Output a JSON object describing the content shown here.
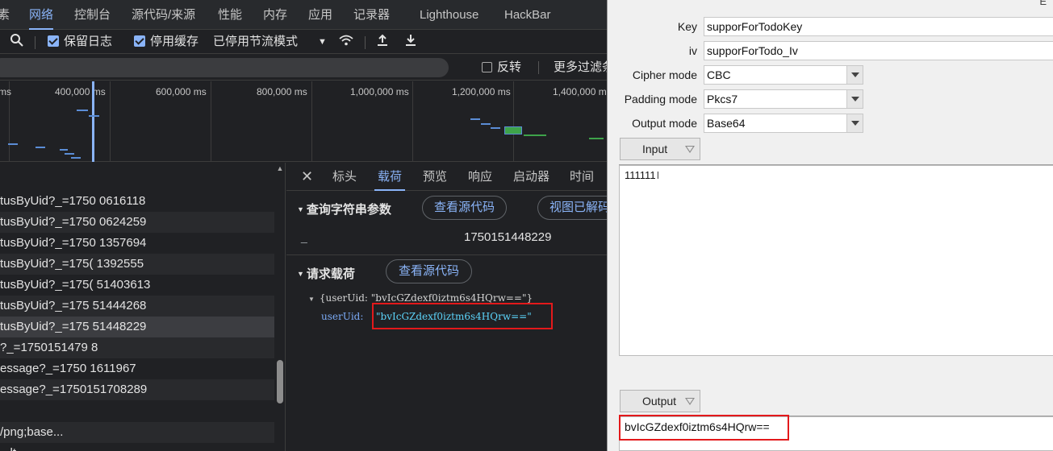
{
  "devtools": {
    "tabs": [
      {
        "label": "素"
      },
      {
        "label": "网络"
      },
      {
        "label": "控制台"
      },
      {
        "label": "源代码/来源"
      },
      {
        "label": "性能"
      },
      {
        "label": "内存"
      },
      {
        "label": "应用"
      },
      {
        "label": "记录器"
      },
      {
        "label": "Lighthouse"
      },
      {
        "label": "HackBar"
      }
    ],
    "active_tab": "网络",
    "toolbar": {
      "preserve_log": "保留日志",
      "disable_cache": "停用缓存",
      "throttling": "已停用节流模式"
    },
    "filter": {
      "invert": "反转",
      "more_filters": "更多过滤条"
    },
    "overview": {
      "labels": [
        "ms",
        "400,000 ms",
        "600,000 ms",
        "800,000 ms",
        "1,000,000 ms",
        "1,200,000 ms",
        "1,400,000 ms"
      ]
    },
    "requests": [
      "tusByUid?_=1750  0616118",
      "tusByUid?_=1750  0624259",
      "tusByUid?_=1750  1357694",
      "tusByUid?_=175(  1392555",
      "tusByUid?_=175(  51403613",
      "tusByUid?_=175   51444268",
      "tusByUid?_=175   51448229",
      "?_=1750151479  8",
      "essage?_=1750  1611967",
      "essage?_=1750151708289",
      "",
      "/png;base...",
      "...lt..."
    ],
    "selected_request_index": 6,
    "detail": {
      "tabs": [
        "标头",
        "载荷",
        "预览",
        "响应",
        "启动器",
        "时间"
      ],
      "active_tab": "载荷",
      "query_title": "查询字符串参数",
      "view_source": "查看源代码",
      "view_decoded": "视图已解码",
      "query_key": "_",
      "query_value": "1750151448229",
      "payload_title": "请求载荷",
      "payload_view_source": "查看源代码",
      "payload_summary": "{userUid: \"bvIcGZdexf0iztm6s4HQrw==\"}",
      "payload_key": "userUid:",
      "payload_value": "\"bvIcGZdexf0iztm6s4HQrw==\""
    }
  },
  "tool": {
    "title_stub": "E",
    "key_label": "Key",
    "key_value": "supporForTodoKey",
    "iv_label": "iv",
    "iv_value": "supporForTodo_Iv",
    "cipher_mode_label": "Cipher mode",
    "cipher_mode_value": "CBC",
    "padding_mode_label": "Padding mode",
    "padding_mode_value": "Pkcs7",
    "output_mode_label": "Output mode",
    "output_mode_value": "Base64",
    "input_header": "Input",
    "input_value": "111111",
    "output_header": "Output",
    "output_value": "bvIcGZdexf0iztm6s4HQrw=="
  },
  "colors": {
    "accent": "#8ab4f8",
    "highlight_box": "#e3191b",
    "devtools_bg": "#202124",
    "tool_bg": "#f0f0f0"
  }
}
